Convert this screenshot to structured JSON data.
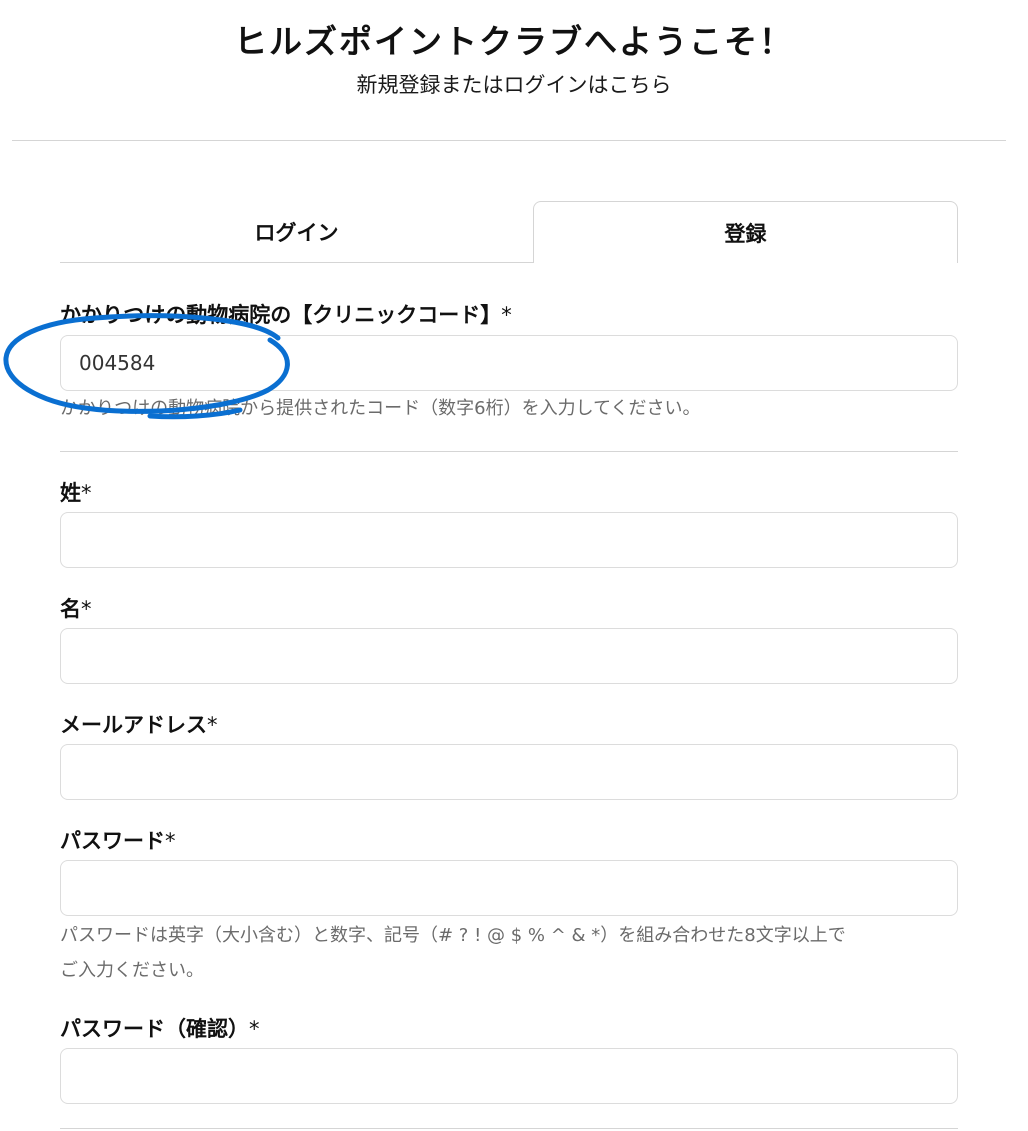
{
  "header": {
    "title": "ヒルズポイントクラブへようこそ！",
    "subtitle": "新規登録またはログインはこちら"
  },
  "tabs": {
    "login": "ログイン",
    "register": "登録",
    "active": "register"
  },
  "form": {
    "clinic_code": {
      "label": "かかりつけの動物病院の【クリニックコード】",
      "required_mark": "*",
      "value": "004584",
      "help": "かかりつけの動物病院から提供されたコード（数字6桁）を入力してください。"
    },
    "last_name": {
      "label": "姓",
      "required_mark": "*",
      "value": ""
    },
    "first_name": {
      "label": "名",
      "required_mark": "*",
      "value": ""
    },
    "email": {
      "label": "メールアドレス",
      "required_mark": "*",
      "value": ""
    },
    "password": {
      "label": "パスワード",
      "required_mark": "*",
      "value": "",
      "help_line1": "パスワードは英字（大小含む）と数字、記号（# ? ! @ $ % ^ & *）を組み合わせた8文字以上で",
      "help_line2": "ご入力ください。"
    },
    "password_confirm": {
      "label": "パスワード（確認）",
      "required_mark": "*",
      "value": ""
    }
  },
  "annotation": {
    "color": "#0a6fd1"
  }
}
